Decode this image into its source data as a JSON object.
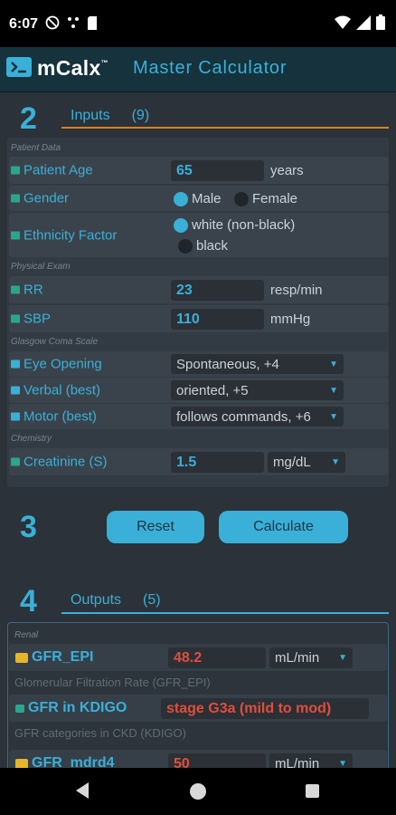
{
  "status_bar": {
    "time": "6:07"
  },
  "app": {
    "brand": "mCalx",
    "trademark": "™",
    "title": "Master Calculator"
  },
  "inputs_section": {
    "step": "2",
    "label": "Inputs",
    "count": "(9)"
  },
  "groups": {
    "patient": "Patient Data",
    "exam": "Physical Exam",
    "gcs": "Glasgow Coma Scale",
    "chem": "Chemistry"
  },
  "fields": {
    "age": {
      "label": "Patient Age",
      "value": "65",
      "unit": "years"
    },
    "gender": {
      "label": "Gender",
      "options": [
        "Male",
        "Female"
      ],
      "selected": "Male"
    },
    "ethnicity": {
      "label": "Ethnicity Factor",
      "options": [
        "white (non-black)",
        "black"
      ],
      "selected": "white (non-black)"
    },
    "rr": {
      "label": "RR",
      "value": "23",
      "unit": "resp/min"
    },
    "sbp": {
      "label": "SBP",
      "value": "110",
      "unit": "mmHg"
    },
    "eye": {
      "label": "Eye Opening",
      "value": "Spontaneous, +4"
    },
    "verbal": {
      "label": "Verbal (best)",
      "value": "oriented, +5"
    },
    "motor": {
      "label": "Motor (best)",
      "value": "follows commands, +6"
    },
    "creatinine": {
      "label": "Creatinine (S)",
      "value": "1.5",
      "unit": "mg/dL"
    }
  },
  "actions": {
    "step": "3",
    "reset": "Reset",
    "calculate": "Calculate"
  },
  "outputs_section": {
    "step": "4",
    "label": "Outputs",
    "count": "(5)"
  },
  "outputs": {
    "group": "Renal",
    "gfr_epi": {
      "label": "GFR_EPI",
      "value": "48.2",
      "unit": "mL/min",
      "desc": "Glomerular Filtration Rate (GFR_EPI)"
    },
    "gfr_kdigo": {
      "label": "GFR in KDIGO",
      "value": "stage G3a (mild to mod)",
      "desc": "GFR categories in CKD (KDIGO)"
    },
    "gfr_mdrd4": {
      "label": "GFR_mdrd4",
      "value": "50",
      "unit": "mL/min"
    }
  },
  "colors": {
    "accent": "#3ab0d8",
    "orange_rule": "#d9821f",
    "output_value": "#e04e3c",
    "background": "#2b3239"
  }
}
